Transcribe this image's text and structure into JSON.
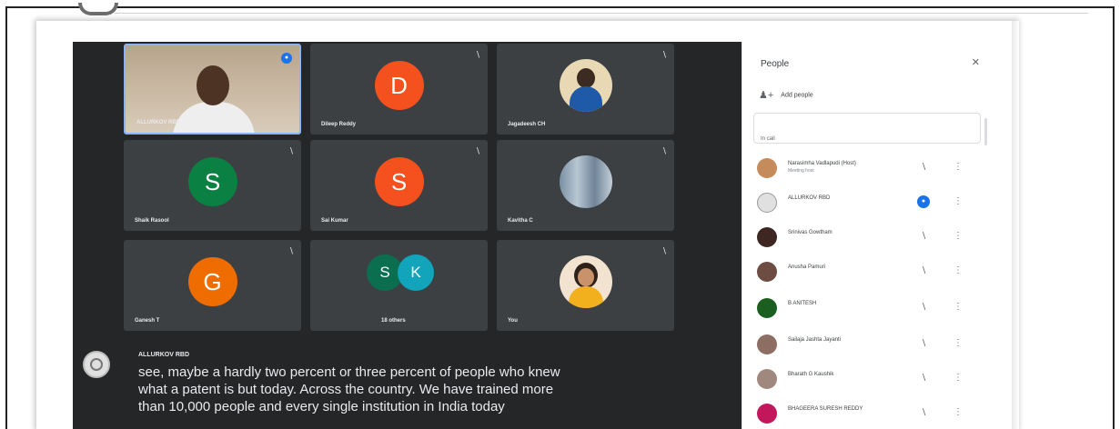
{
  "tiles": [
    {
      "name": "ALLURKOV RBD",
      "type": "video"
    },
    {
      "name": "Dileep Reddy",
      "letter": "D",
      "color": "#f4511e"
    },
    {
      "name": "Jagadeesh CH",
      "type": "photo"
    },
    {
      "name": "Shaik Rasool",
      "letter": "S",
      "color": "#0b8043"
    },
    {
      "name": "Sai Kumar",
      "letter": "S",
      "color": "#f4511e"
    },
    {
      "name": "Kavitha C",
      "type": "photo"
    },
    {
      "name": "Ganesh T",
      "letter": "G",
      "color": "#ef6c00"
    },
    {
      "name": "18 others",
      "letters": [
        "S",
        "K"
      ],
      "colors": [
        "#0b6e4f",
        "#12a4bb"
      ]
    },
    {
      "name": "You",
      "type": "photo"
    }
  ],
  "caption": {
    "speaker": "ALLURKOV RBD",
    "text": "see, maybe a hardly two percent or three percent of people who knew what a patent is but today. Across the country. We have trained more than 10,000 people and every single institution in India today"
  },
  "panel": {
    "title": "People",
    "close_icon": "close-icon",
    "add_people": "Add people",
    "section": "In call"
  },
  "participants": [
    {
      "name": "Narasimha Vadlapudi (Host)",
      "sub": "Meeting host",
      "color": "#c58b5a"
    },
    {
      "name": "ALLURKOV RBD",
      "sub": "",
      "color": "#e0e0e0",
      "active": true
    },
    {
      "name": "Srinivas Gowtham",
      "sub": "",
      "color": "#3e2723"
    },
    {
      "name": "Anusha Pamuri",
      "sub": "",
      "color": "#6d4c41"
    },
    {
      "name": "B ANITESH",
      "sub": "",
      "color": "#1b5e20"
    },
    {
      "name": "Sailaja Jashta Jayanti",
      "sub": "",
      "color": "#8d6e63"
    },
    {
      "name": "Bharath G Kaushik",
      "sub": "",
      "color": "#a1887f"
    },
    {
      "name": "BHAGEERA SURESH REDDY",
      "sub": "",
      "color": "#c2185b"
    }
  ]
}
